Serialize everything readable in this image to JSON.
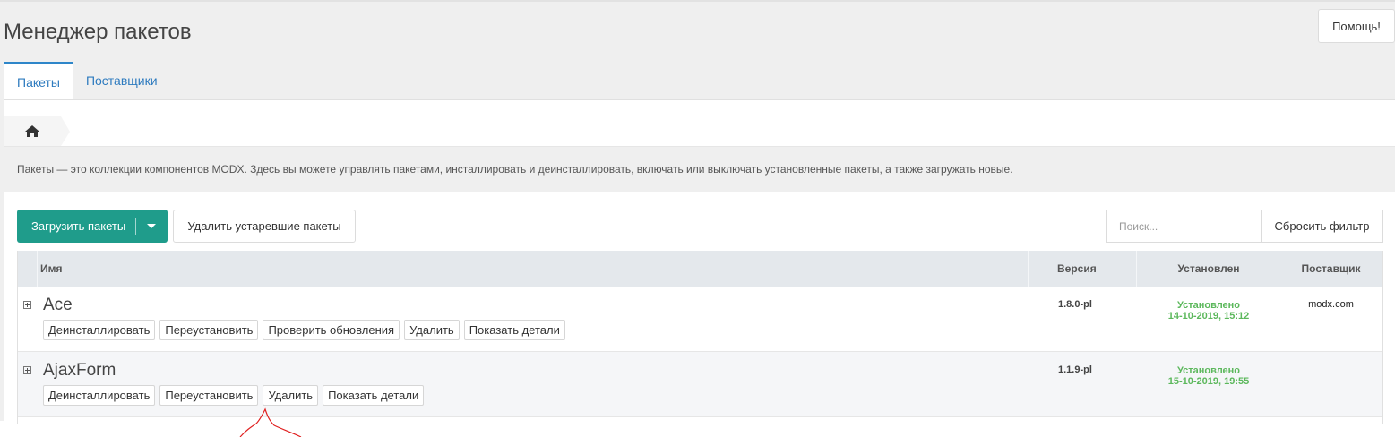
{
  "page": {
    "title": "Менеджер пакетов",
    "help_label": "Помощь!"
  },
  "tabs": [
    {
      "label": "Пакеты",
      "active": true
    },
    {
      "label": "Поставщики",
      "active": false
    }
  ],
  "breadcrumb": {
    "home_icon": "home-icon"
  },
  "description": "Пакеты — это коллекции компонентов MODX. Здесь вы можете управлять пакетами, инсталлировать и деинсталлировать, включать или выключать установленные пакеты, а также загружать новые.",
  "toolbar": {
    "upload_label": "Загрузить пакеты",
    "remove_outdated_label": "Удалить устаревшие пакеты",
    "search_placeholder": "Поиск...",
    "reset_filter_label": "Сбросить фильтр"
  },
  "grid": {
    "columns": [
      "Имя",
      "Версия",
      "Установлен",
      "Поставщик"
    ],
    "rows": [
      {
        "name": "Ace",
        "actions": [
          "Деинсталлировать",
          "Переустановить",
          "Проверить обновления",
          "Удалить",
          "Показать детали"
        ],
        "version": "1.8.0-pl",
        "installed_status": "Установлено",
        "installed_date": "14-10-2019, 15:12",
        "provider": "modx.com"
      },
      {
        "name": "AjaxForm",
        "actions": [
          "Деинсталлировать",
          "Переустановить",
          "Удалить",
          "Показать детали"
        ],
        "version": "1.1.9-pl",
        "installed_status": "Установлено",
        "installed_date": "15-10-2019, 19:55",
        "provider": ""
      }
    ]
  },
  "colors": {
    "accent": "#1f9c8b",
    "tab_active": "#2e86c9",
    "installed_green": "#5cb85c",
    "annotation": "#e02020"
  }
}
